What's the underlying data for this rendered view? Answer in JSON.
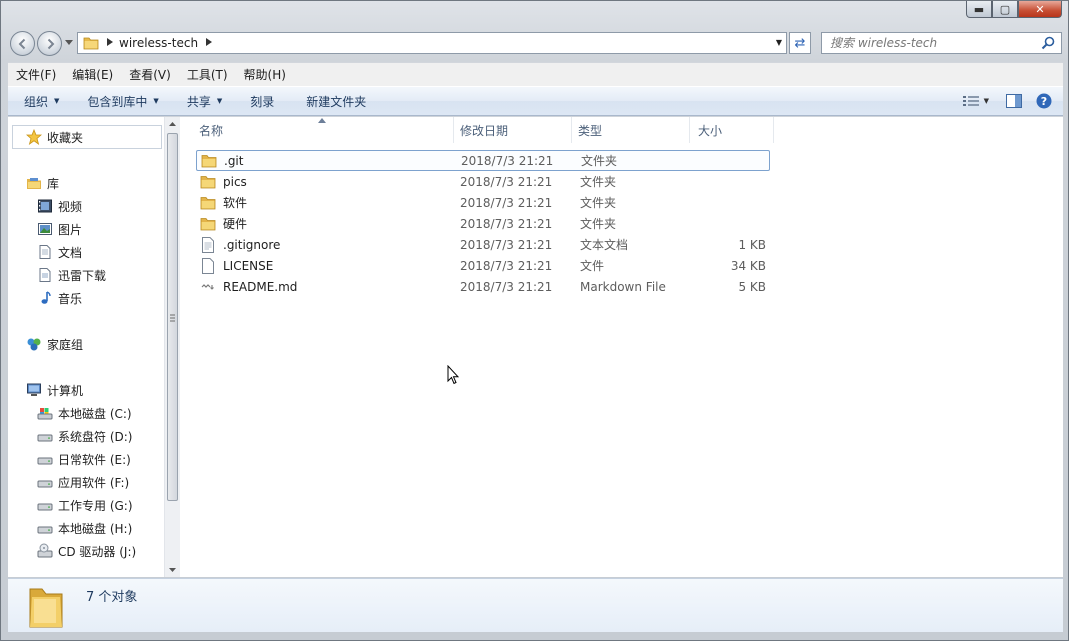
{
  "window": {
    "min_glyph": "▬",
    "max_glyph": "▢",
    "close_glyph": "✕"
  },
  "address": {
    "crumb": "wireless-tech",
    "dropdown_glyph": "▼",
    "refresh_glyph": "⇄"
  },
  "search": {
    "placeholder": "搜索 wireless-tech"
  },
  "menu": {
    "items": [
      "文件(F)",
      "编辑(E)",
      "查看(V)",
      "工具(T)",
      "帮助(H)"
    ]
  },
  "toolbar": {
    "organize": "组织",
    "include_library": "包含到库中",
    "share": "共享",
    "burn": "刻录",
    "new_folder": "新建文件夹"
  },
  "nav": {
    "favorites": "收藏夹",
    "libraries": "库",
    "lib_items": [
      "视频",
      "图片",
      "文档",
      "迅雷下载",
      "音乐"
    ],
    "homegroup": "家庭组",
    "computer": "计算机",
    "drives": [
      "本地磁盘 (C:)",
      "系统盘符 (D:)",
      "日常软件 (E:)",
      "应用软件 (F:)",
      "工作专用 (G:)",
      "本地磁盘 (H:)",
      "CD 驱动器 (J:)"
    ]
  },
  "columns": {
    "name": "名称",
    "date": "修改日期",
    "type": "类型",
    "size": "大小"
  },
  "files": [
    {
      "name": ".git",
      "date": "2018/7/3 21:21",
      "type": "文件夹",
      "size": "",
      "icon": "folder-icon",
      "selected": true
    },
    {
      "name": "pics",
      "date": "2018/7/3 21:21",
      "type": "文件夹",
      "size": "",
      "icon": "folder-icon"
    },
    {
      "name": "软件",
      "date": "2018/7/3 21:21",
      "type": "文件夹",
      "size": "",
      "icon": "folder-icon"
    },
    {
      "name": "硬件",
      "date": "2018/7/3 21:21",
      "type": "文件夹",
      "size": "",
      "icon": "folder-icon"
    },
    {
      "name": ".gitignore",
      "date": "2018/7/3 21:21",
      "type": "文本文档",
      "size": "1 KB",
      "icon": "text-file-icon"
    },
    {
      "name": "LICENSE",
      "date": "2018/7/3 21:21",
      "type": "文件",
      "size": "34 KB",
      "icon": "blank-file-icon"
    },
    {
      "name": "README.md",
      "date": "2018/7/3 21:21",
      "type": "Markdown File",
      "size": "5 KB",
      "icon": "markdown-file-icon"
    }
  ],
  "details": {
    "count_text": "7 个对象"
  }
}
